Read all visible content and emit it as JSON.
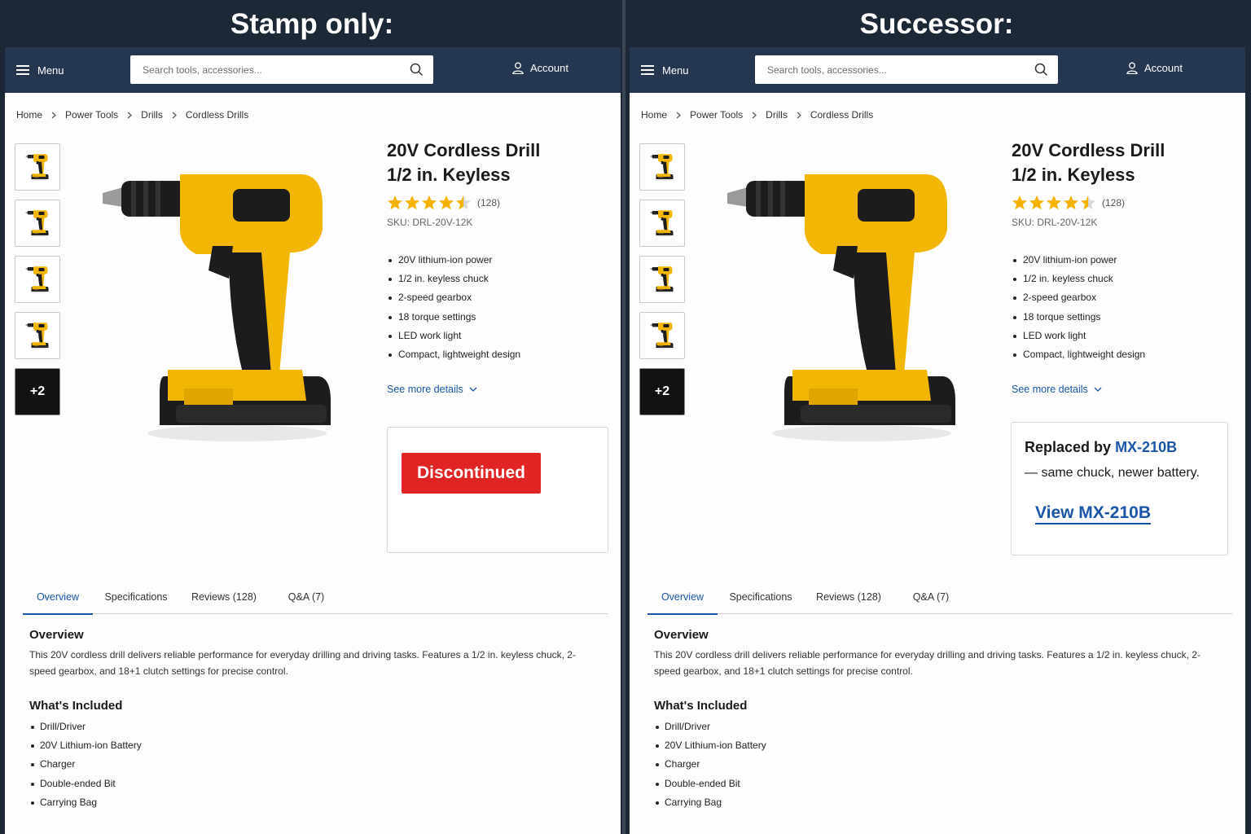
{
  "panels": {
    "left": {
      "heading": "Stamp only:",
      "status": {
        "badge": "Discontinued",
        "badge_color": "#e02424"
      }
    },
    "right": {
      "heading": "Successor:",
      "successor": {
        "prefix": "Replaced by",
        "model": "MX-210B",
        "note": "— same chuck, newer battery.",
        "link_label": "View MX-210B"
      }
    }
  },
  "nav": {
    "menu_label": "Menu",
    "search_placeholder": "Search tools, accessories...",
    "account_label": "Account",
    "icons": [
      "hamburger-icon",
      "search-icon",
      "user-icon"
    ]
  },
  "breadcrumb": [
    "Home",
    "Power Tools",
    "Drills",
    "Cordless Drills"
  ],
  "gallery": {
    "more_label": "+2",
    "thumb_count": 4
  },
  "product": {
    "title_line1": "20V Cordless Drill",
    "title_line2": "1/2 in. Keyless",
    "rating": 4.5,
    "rating_count": "(128)",
    "sku": "SKU: DRL-20V-12K",
    "features": [
      "20V lithium-ion power",
      "1/2 in. keyless chuck",
      "2-speed gearbox",
      "18 torque settings",
      "LED work light",
      "Compact, lightweight design"
    ],
    "see_more": "See more details"
  },
  "tabs": [
    "Overview",
    "Specifications",
    "Reviews (128)",
    "Q&A (7)"
  ],
  "active_tab": "Overview",
  "overview": {
    "heading": "Overview",
    "text": "This 20V cordless drill delivers reliable performance for everyday drilling and driving tasks. Features a 1/2 in. keyless chuck, 2-speed gearbox, and 18+1 clutch settings for precise control.",
    "included_heading": "What's Included",
    "included": [
      "Drill/Driver",
      "20V Lithium-ion Battery",
      "Charger",
      "Double-ended Bit",
      "Carrying Bag"
    ]
  },
  "colors": {
    "nav_bg": "#243650",
    "accent_link": "#1a56a8",
    "star": "#f5b301",
    "drill_body": "#f2b705",
    "drill_dark": "#1c1c1c"
  }
}
